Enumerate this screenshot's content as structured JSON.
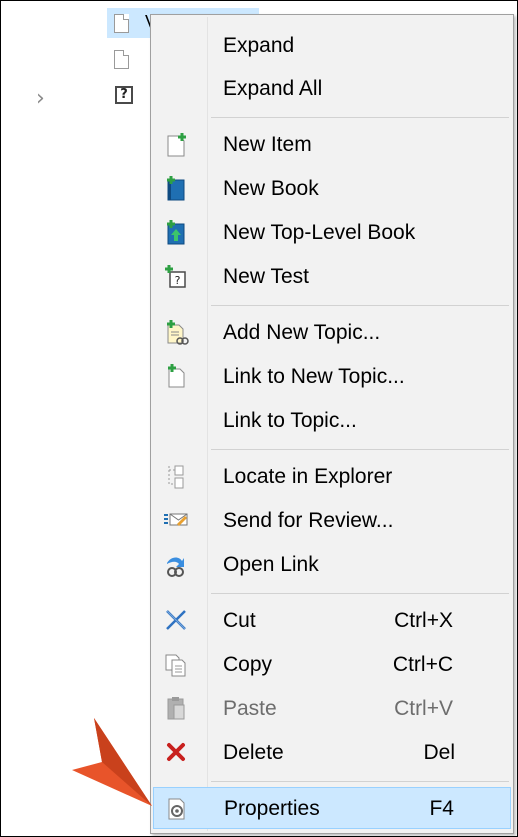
{
  "tree": {
    "selected_label": "Vid",
    "test_glyph": "?",
    "chevron": "›"
  },
  "menu": {
    "items": [
      {
        "label": "Expand",
        "icon": null
      },
      {
        "label": "Expand All",
        "icon": null
      },
      {
        "label": "New Item",
        "icon": "new-item-icon"
      },
      {
        "label": "New Book",
        "icon": "new-book-icon"
      },
      {
        "label": "New Top-Level Book",
        "icon": "new-top-level-book-icon"
      },
      {
        "label": "New Test",
        "icon": "new-test-icon"
      },
      {
        "label": "Add New Topic...",
        "icon": "add-new-topic-icon"
      },
      {
        "label": "Link to New Topic...",
        "icon": "link-new-topic-icon"
      },
      {
        "label": "Link to Topic...",
        "icon": null
      },
      {
        "label": "Locate in Explorer",
        "icon": "locate-explorer-icon"
      },
      {
        "label": "Send for Review...",
        "icon": "send-review-icon"
      },
      {
        "label": "Open Link",
        "icon": "open-link-icon"
      },
      {
        "label": "Cut",
        "shortcut": "Ctrl+X",
        "icon": "cut-icon"
      },
      {
        "label": "Copy",
        "shortcut": "Ctrl+C",
        "icon": "copy-icon"
      },
      {
        "label": "Paste",
        "shortcut": "Ctrl+V",
        "icon": "paste-icon",
        "disabled": true
      },
      {
        "label": "Delete",
        "shortcut": "Del",
        "icon": "delete-icon"
      },
      {
        "label": "Properties",
        "shortcut": "F4",
        "icon": "properties-icon",
        "highlighted": true
      }
    ]
  },
  "colors": {
    "highlight": "#cce8ff",
    "pointer": "#e8542a",
    "menu_bg": "#f2f2f2"
  }
}
